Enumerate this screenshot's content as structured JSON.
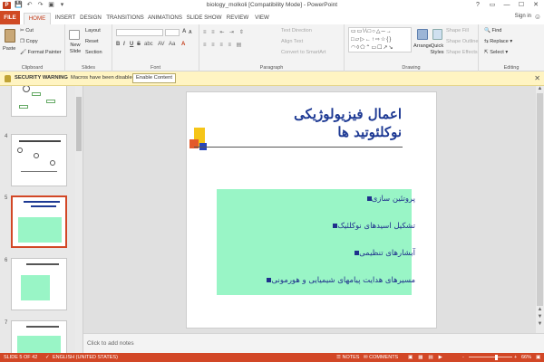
{
  "window": {
    "app_icon": "P",
    "title": "biology_molkoli [Compatibility Mode] - PowerPoint",
    "controls": [
      "?",
      "▭",
      "—",
      "☐",
      "✕"
    ]
  },
  "qat_icons": [
    "save-icon",
    "undo-icon",
    "redo-icon",
    "slideshow-icon",
    "customize-icon"
  ],
  "tabs": [
    {
      "label": "FILE"
    },
    {
      "label": "HOME"
    },
    {
      "label": "INSERT"
    },
    {
      "label": "DESIGN"
    },
    {
      "label": "TRANSITIONS"
    },
    {
      "label": "ANIMATIONS"
    },
    {
      "label": "SLIDE SHOW"
    },
    {
      "label": "REVIEW"
    },
    {
      "label": "VIEW"
    }
  ],
  "signin": "Sign in",
  "ribbon": {
    "clipboard": {
      "paste": "Paste",
      "cut": "Cut",
      "copy": "Copy",
      "format_painter": "Format Painter",
      "label": "Clipboard"
    },
    "slides": {
      "new_slide": "New Slide",
      "layout": "Layout",
      "reset": "Reset",
      "section": "Section",
      "label": "Slides"
    },
    "font": {
      "label": "Font",
      "bold": "B",
      "italic": "I",
      "underline": "U",
      "strike": "S",
      "shadow": "abc",
      "grow": "A",
      "shrink": "A",
      "clear": "A",
      "spacing": "AV",
      "case": "Aa"
    },
    "paragraph": {
      "text_direction": "Text Direction",
      "align_text": "Align Text",
      "convert": "Convert to SmartArt",
      "label": "Paragraph"
    },
    "drawing": {
      "arrange": "Arrange",
      "quick_styles": "Quick Styles",
      "shape_fill": "Shape Fill",
      "shape_outline": "Shape Outline",
      "shape_effects": "Shape Effects",
      "label": "Drawing",
      "shapes_preview": "▭▭\\\\□○△─→\n□▱▷←↑⇨☆{}\n◠◊⬠⌃▭☐↗↘"
    },
    "editing": {
      "find": "Find",
      "replace": "Replace",
      "select": "Select",
      "label": "Editing"
    }
  },
  "security": {
    "title": "SECURITY WARNING",
    "message": "Macros have been disabled.",
    "button": "Enable Content",
    "close": "✕"
  },
  "thumbnails": [
    {
      "number": "",
      "selected": false
    },
    {
      "number": "4",
      "selected": false
    },
    {
      "number": "5",
      "selected": true
    },
    {
      "number": "6",
      "selected": false
    },
    {
      "number": "7",
      "selected": false
    }
  ],
  "slide": {
    "title_line1": "اعمال فیزیولوژیکی",
    "title_line2": "نوکلئوتید ها",
    "bullets": [
      "پروتئین سازی",
      "تشکیل اسیدهای نوکلئیک",
      "آبشارهای تنظیمی",
      "مسیرهای هدایت پیامهای شیمیایی و هورمونی"
    ],
    "colors": {
      "title": "#1e3a94",
      "box": "#99f5c6",
      "bullet": "#1f2f8c"
    }
  },
  "notes_placeholder": "Click to add notes",
  "status": {
    "slide_info": "SLIDE 5 OF 42",
    "language": "ENGLISH (UNITED STATES)",
    "notes": "NOTES",
    "comments": "COMMENTS",
    "zoom": "66%",
    "zoom_minus": "-",
    "zoom_plus": "+"
  }
}
